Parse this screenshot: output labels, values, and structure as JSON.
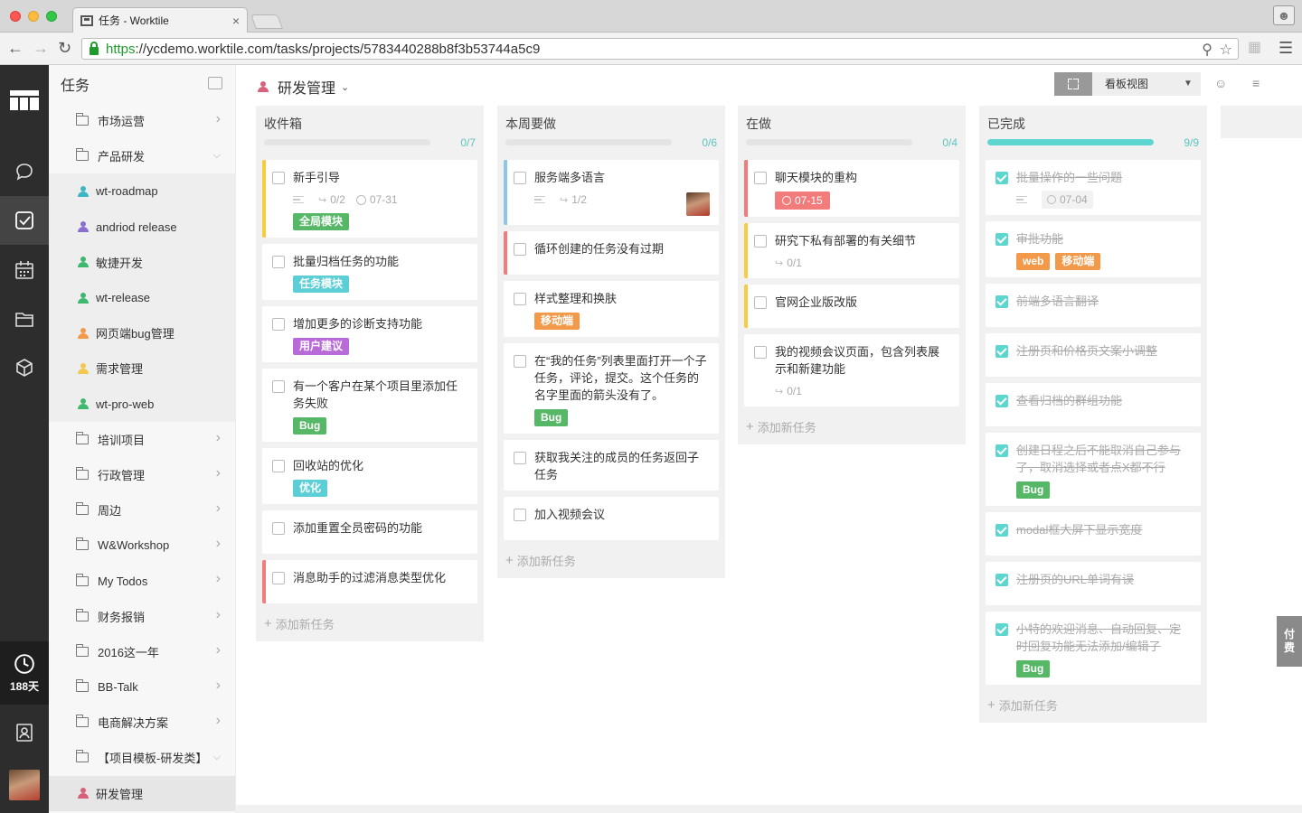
{
  "browser": {
    "tab_title": "任务 - Worktile",
    "tab_close": "×",
    "url_https": "https",
    "url_rest": "://ycdemo.worktile.com/tasks/projects/5783440288b8f3b53744a5c9"
  },
  "rail": {
    "trial_days": "188天"
  },
  "sidebar": {
    "title": "任务",
    "items": [
      {
        "label": "市场运营",
        "kind": "folder"
      },
      {
        "label": "产品研发",
        "kind": "folder-open"
      },
      {
        "label": "wt-roadmap",
        "kind": "project",
        "color": "#3fb5c6"
      },
      {
        "label": "andriod release",
        "kind": "project",
        "color": "#8a6fd1"
      },
      {
        "label": "敏捷开发",
        "kind": "project",
        "color": "#3db96e"
      },
      {
        "label": "wt-release",
        "kind": "project",
        "color": "#3db96e"
      },
      {
        "label": "网页端bug管理",
        "kind": "project",
        "color": "#f2994a"
      },
      {
        "label": "需求管理",
        "kind": "project",
        "color": "#f2c94c"
      },
      {
        "label": "wt-pro-web",
        "kind": "project",
        "color": "#3db96e"
      },
      {
        "label": "培训项目",
        "kind": "folder"
      },
      {
        "label": "行政管理",
        "kind": "folder"
      },
      {
        "label": "周边",
        "kind": "folder"
      },
      {
        "label": "W&Workshop",
        "kind": "folder"
      },
      {
        "label": "My Todos",
        "kind": "folder"
      },
      {
        "label": "财务报销",
        "kind": "folder"
      },
      {
        "label": "2016这一年",
        "kind": "folder"
      },
      {
        "label": "BB-Talk",
        "kind": "folder"
      },
      {
        "label": "电商解决方案",
        "kind": "folder"
      },
      {
        "label": "【项目模板-研发类】",
        "kind": "folder-open"
      },
      {
        "label": "研发管理",
        "kind": "project",
        "color": "#d9607a"
      }
    ]
  },
  "header": {
    "project_title": "研发管理",
    "view_label": "看板视图"
  },
  "pay_tab": "付费",
  "columns": [
    {
      "title": "收件箱",
      "count": "0/7",
      "progress": 0,
      "add_label": "添加新任务",
      "cards": [
        {
          "title": "新手引导",
          "bar": "#f7cc3f",
          "subtasks": "0/2",
          "due": "07-31",
          "tags": [
            {
              "text": "全局模块",
              "color": "#56b866"
            }
          ]
        },
        {
          "title": "批量归档任务的功能",
          "bar": "",
          "tags": [
            {
              "text": "任务模块",
              "color": "#5ccfd6"
            }
          ]
        },
        {
          "title": "增加更多的诊断支持功能",
          "bar": "",
          "tags": [
            {
              "text": "用户建议",
              "color": "#b96ad9"
            }
          ]
        },
        {
          "title": "有一个客户在某个项目里添加任务失败",
          "bar": "",
          "tags": [
            {
              "text": "Bug",
              "color": "#56b866"
            }
          ]
        },
        {
          "title": "回收站的优化",
          "bar": "",
          "tags": [
            {
              "text": "优化",
              "color": "#5ccfd6"
            }
          ]
        },
        {
          "title": "添加重置全员密码的功能",
          "bar": "",
          "tags": []
        },
        {
          "title": "消息助手的过滤消息类型优化",
          "bar": "#f27b7b",
          "tags": []
        }
      ]
    },
    {
      "title": "本周要做",
      "count": "0/6",
      "progress": 0,
      "add_label": "添加新任务",
      "cards": [
        {
          "title": "服务端多语言",
          "bar": "#8ec6ea",
          "subtasks": "1/2",
          "avatar": true,
          "tags": []
        },
        {
          "title": "循环创建的任务没有过期",
          "bar": "#f27b7b",
          "tags": []
        },
        {
          "title": "样式整理和换肤",
          "bar": "",
          "tags": [
            {
              "text": "移动端",
              "color": "#f2994a"
            }
          ]
        },
        {
          "title": "在“我的任务”列表里面打开一个子任务，评论，提交。这个任务的名字里面的箭头没有了。",
          "bar": "",
          "tags": [
            {
              "text": "Bug",
              "color": "#56b866"
            }
          ]
        },
        {
          "title": "获取我关注的成员的任务返回子任务",
          "bar": "",
          "tags": []
        },
        {
          "title": "加入视频会议",
          "bar": "",
          "tags": []
        }
      ]
    },
    {
      "title": "在做",
      "count": "0/4",
      "progress": 0,
      "add_label": "添加新任务",
      "cards": [
        {
          "title": "聊天模块的重构",
          "bar": "#f27b7b",
          "due_red": "07-15",
          "tags": []
        },
        {
          "title": "研究下私有部署的有关细节",
          "bar": "#f7cc3f",
          "subtasks": "0/1",
          "tags": []
        },
        {
          "title": "官网企业版改版",
          "bar": "#f7cc3f",
          "tags": []
        },
        {
          "title": "我的视频会议页面，包含列表展示和新建功能",
          "bar": "",
          "subtasks": "0/1",
          "tags": []
        }
      ]
    },
    {
      "title": "已完成",
      "count": "9/9",
      "progress": 1,
      "add_label": "添加新任务",
      "cards": [
        {
          "title": "批量操作的一些问题",
          "done": true,
          "due_grey": "07-04",
          "tags": []
        },
        {
          "title": "审批功能",
          "done": true,
          "tags": [
            {
              "text": "web",
              "color": "#f2994a"
            },
            {
              "text": "移动端",
              "color": "#f2994a"
            }
          ]
        },
        {
          "title": "前端多语言翻译",
          "done": true,
          "tags": []
        },
        {
          "title": "注册页和价格页文案小调整",
          "done": true,
          "tags": []
        },
        {
          "title": "查看归档的群组功能",
          "done": true,
          "tags": []
        },
        {
          "title": "创建日程之后不能取消自己参与了，取消选择或者点X都不行",
          "done": true,
          "tags": [
            {
              "text": "Bug",
              "color": "#56b866"
            }
          ]
        },
        {
          "title": "modal框大屏下显示宽度",
          "done": true,
          "tags": []
        },
        {
          "title": "注册页的URL单词有误",
          "done": true,
          "tags": []
        },
        {
          "title": "小特的欢迎消息、自动回复、定时回复功能无法添加/编辑了",
          "done": true,
          "tags": [
            {
              "text": "Bug",
              "color": "#56b866"
            }
          ]
        }
      ]
    }
  ]
}
